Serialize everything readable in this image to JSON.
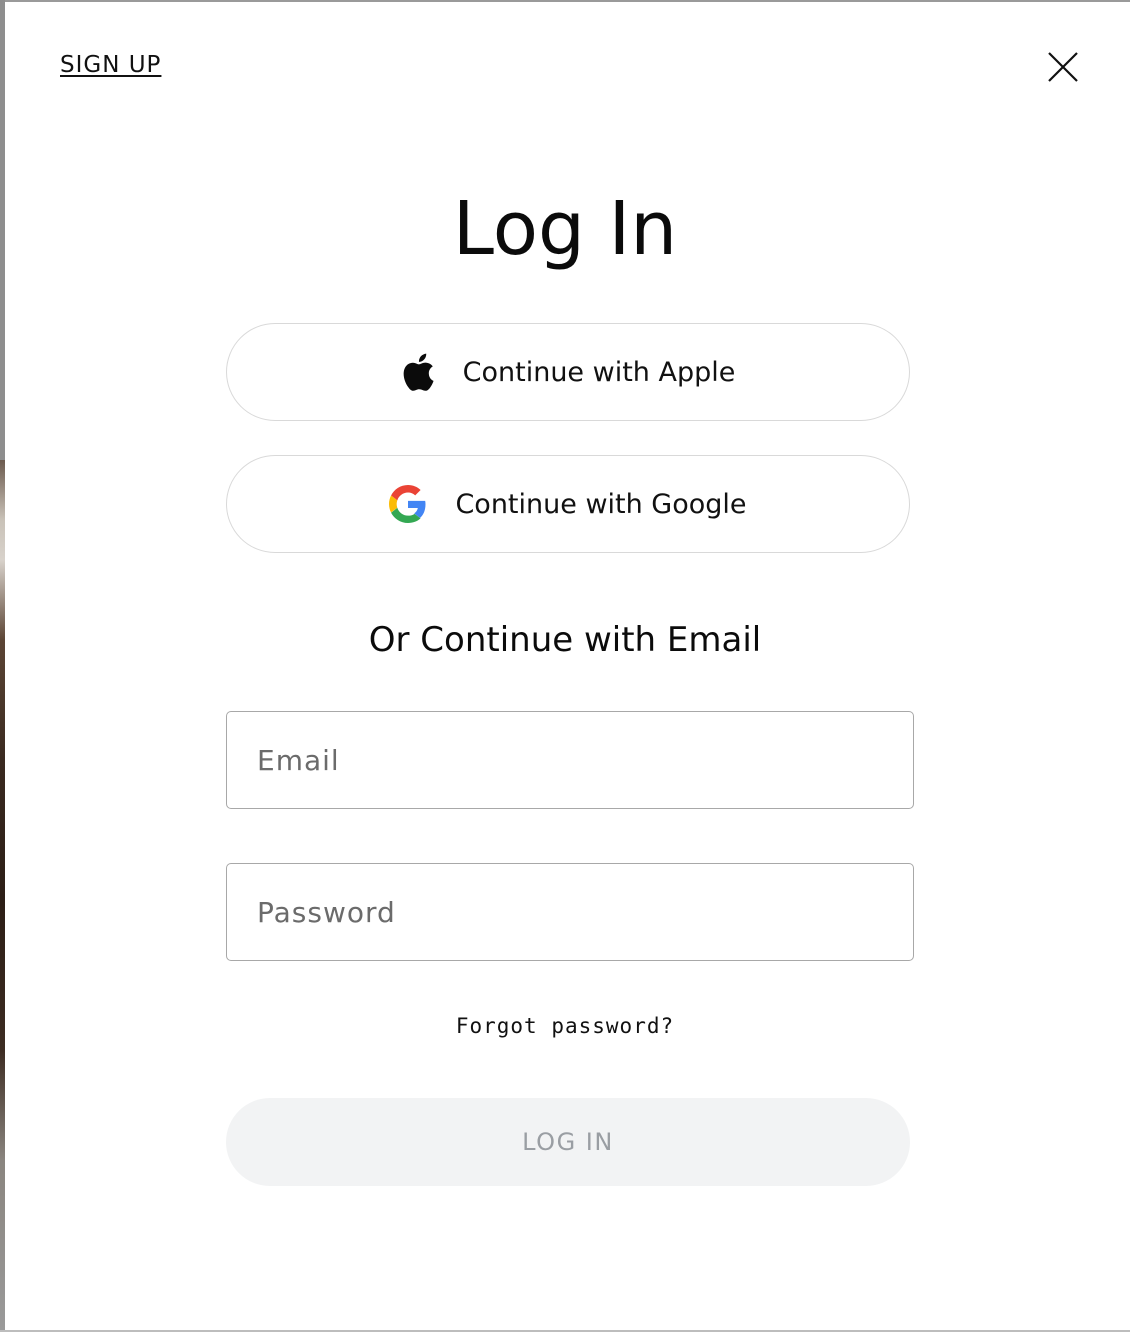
{
  "header": {
    "signup_label": "SIGN UP"
  },
  "title": "Log In",
  "oauth": {
    "apple_label": "Continue with Apple",
    "google_label": "Continue with Google"
  },
  "email_section": {
    "heading": "Or Continue with Email",
    "email_placeholder": "Email",
    "password_placeholder": "Password",
    "email_value": "",
    "password_value": ""
  },
  "forgot_label": "Forgot password?",
  "submit_label": "LOG IN",
  "icons": {
    "close": "close-icon",
    "apple": "apple-icon",
    "google": "google-icon"
  },
  "colors": {
    "google_blue": "#4285F4",
    "google_red": "#EA4335",
    "google_yellow": "#FBBC05",
    "google_green": "#34A853",
    "disabled_button_bg": "#f2f3f4",
    "disabled_button_text": "#9a9ea3"
  }
}
